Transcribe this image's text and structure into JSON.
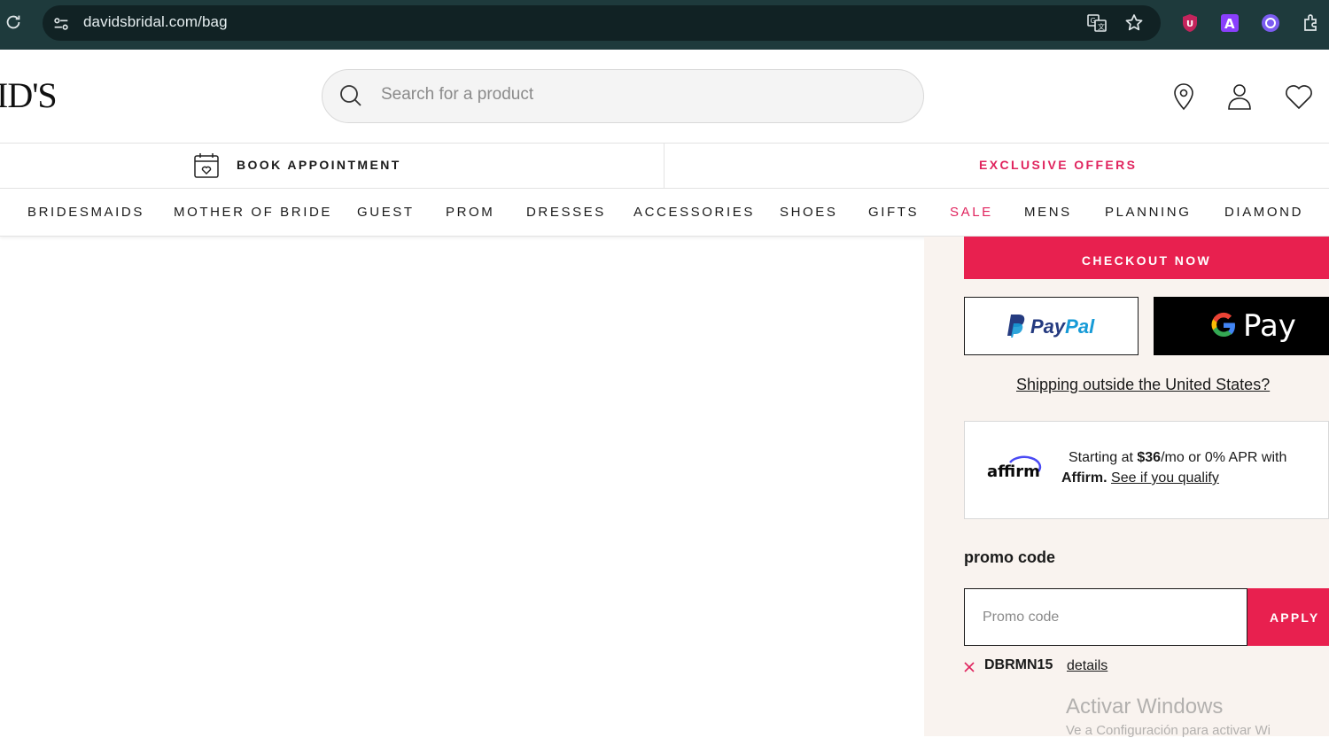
{
  "browser": {
    "url": "davidsbridal.com/bag",
    "icons": [
      "reload-icon",
      "site-info-icon",
      "translate-icon",
      "bookmark-star-icon",
      "ublock-icon",
      "extension-a-icon",
      "extension-purple-icon",
      "extensions-puzzle-icon"
    ]
  },
  "header": {
    "logo_text": "ID'S",
    "search_placeholder": "Search for a product",
    "icons": [
      "location-icon",
      "account-icon",
      "wishlist-heart-icon"
    ]
  },
  "utility_bar": {
    "book_label": "BOOK APPOINTMENT",
    "offers_label": "EXCLUSIVE OFFERS"
  },
  "nav": {
    "items": [
      "BRIDESMAIDS",
      "MOTHER OF BRIDE",
      "GUEST",
      "PROM",
      "DRESSES",
      "ACCESSORIES",
      "SHOES",
      "GIFTS",
      "SALE",
      "MENS",
      "PLANNING",
      "DIAMOND"
    ]
  },
  "summary": {
    "checkout_label": "CHECKOUT NOW",
    "paypal_pay": "Pay",
    "paypal_pal": "Pal",
    "gpay_label": "Pay",
    "shipping_link": "Shipping outside the United States?",
    "affirm": {
      "logo": "affirm",
      "line1_prefix": "Starting at ",
      "amount": "$36",
      "line1_suffix": "/mo or 0% APR with",
      "brand": "Affirm.",
      "qualify_link": "See if you qualify"
    },
    "promo": {
      "label": "promo code",
      "placeholder": "Promo code",
      "apply_label": "APPLY",
      "applied_code": "DBRMN15",
      "details_link": "details"
    }
  },
  "watermark": {
    "line1": "Activar Windows",
    "line2": "Ve a Configuración para activar Wi"
  },
  "colors": {
    "chrome": "#1e3a3c",
    "accent": "#e8204f",
    "offers": "#e0245e",
    "panel": "#f9f3ef"
  }
}
